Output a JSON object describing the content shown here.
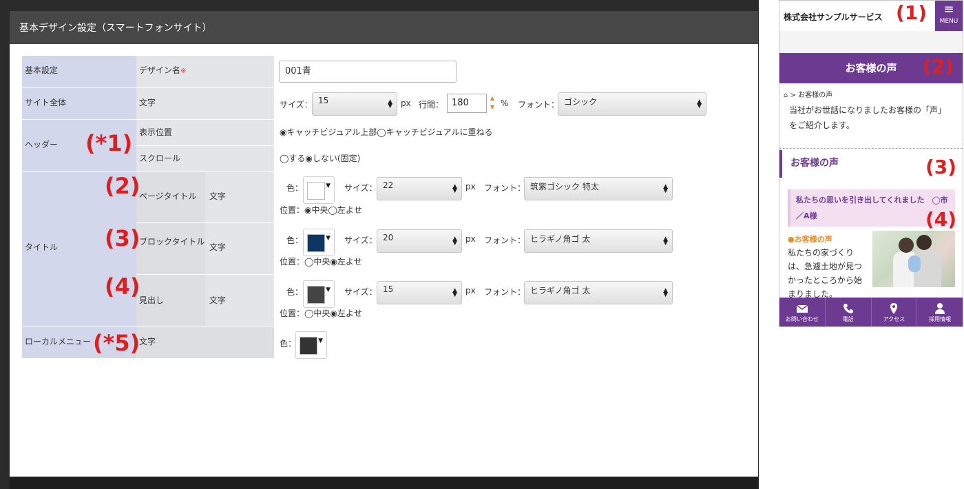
{
  "modal": {
    "title": "基本デザイン設定（スマートフォンサイト）"
  },
  "rows": {
    "basic": {
      "group": "基本設定",
      "item": "デザイン名",
      "required_mark": "※",
      "value": "001青"
    },
    "site": {
      "group": "サイト全体",
      "item": "文字",
      "size_label": "サイズ：",
      "size_value": "15",
      "size_unit": "px",
      "line_label": "行間：",
      "line_value": "180",
      "line_unit": "%",
      "font_label": "フォント：",
      "font_value": "ゴシック"
    },
    "header": {
      "group": "ヘッダー",
      "position_item": "表示位置",
      "position_options": "◉キャッチビジュアル上部◯キャッチビジュアルに重ねる",
      "scroll_item": "スクロール",
      "scroll_options": "◯する◉しない(固定)"
    },
    "title": {
      "group": "タイトル",
      "page_title": {
        "item": "ページタイトル",
        "sub": "文字",
        "color_label": "色：",
        "color": "#ffffff",
        "size_label": "サイズ：",
        "size_value": "22",
        "size_unit": "px",
        "font_label": "フォント：",
        "font_value": "筑紫ゴシック 特太",
        "position": "位置：◉中央◯左よせ"
      },
      "block_title": {
        "item": "ブロックタイトル",
        "sub": "文字",
        "color_label": "色：",
        "color": "#0d3566",
        "size_label": "サイズ：",
        "size_value": "20",
        "size_unit": "px",
        "font_label": "フォント：",
        "font_value": "ヒラギノ角ゴ 太",
        "position": "位置：◯中央◉左よせ"
      },
      "heading": {
        "item": "見出し",
        "sub": "文字",
        "color_label": "色：",
        "color": "#444444",
        "size_label": "サイズ：",
        "size_value": "15",
        "size_unit": "px",
        "font_label": "フォント：",
        "font_value": "ヒラギノ角ゴ 太",
        "position": "位置：◯中央◉左よせ"
      }
    },
    "local_menu": {
      "group": "ローカルメニュー",
      "item": "文字",
      "color_label": "色：",
      "color": "#333333"
    }
  },
  "annotations": {
    "a1": "(*1)",
    "a2": "(2)",
    "a3": "(3)",
    "a4": "(4)",
    "a5": "(*5)",
    "p1": "(1)",
    "p2": "(2)",
    "p3": "(3)",
    "p4": "(4)"
  },
  "phone": {
    "company": "株式会社サンプルサービス",
    "menu_label": "MENU",
    "page_title": "お客様の声",
    "breadcrumb_sep": ">",
    "breadcrumb_current": "お客様の声",
    "intro": "当社がお世話になりましたお客様の「声」をご紹介します。",
    "block_title": "お客様の声",
    "heading": "私たちの思いを引き出してくれました　◯市／A様",
    "sub_heading": "●お客様の声",
    "body": "私たちの家づくりは、急遽土地が見つかったところから始まりました。",
    "nav": [
      "お問い合わせ",
      "電話",
      "アクセス",
      "採用情報"
    ],
    "accent_color": "#6c3b91"
  }
}
